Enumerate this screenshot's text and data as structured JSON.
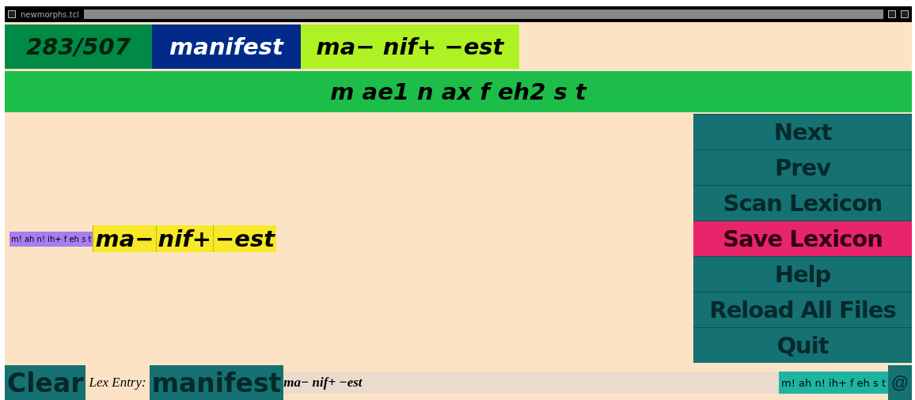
{
  "window": {
    "title": "newmorphs.tcl"
  },
  "header": {
    "counter": "283/507",
    "word": "manifest",
    "morphs": "ma− nif+ −est"
  },
  "pronunciation": "m ae1 n ax f eh2 s t",
  "analysis": {
    "phones": "m! ah n! ih+ f eh s t",
    "segments": [
      "ma−",
      "nif+",
      "−est"
    ]
  },
  "buttons": [
    {
      "label": "Next",
      "highlighted": false
    },
    {
      "label": "Prev",
      "highlighted": false
    },
    {
      "label": "Scan Lexicon",
      "highlighted": false
    },
    {
      "label": "Save Lexicon",
      "highlighted": true
    },
    {
      "label": "Help",
      "highlighted": false
    },
    {
      "label": "Reload All Files",
      "highlighted": false
    },
    {
      "label": "Quit",
      "highlighted": false
    }
  ],
  "footer": {
    "clear": "Clear",
    "lex_label": "Lex Entry:",
    "word": "manifest",
    "entry": "ma− nif+ −est",
    "phones": "m! ah n! ih+ f eh s t",
    "at": "@"
  }
}
